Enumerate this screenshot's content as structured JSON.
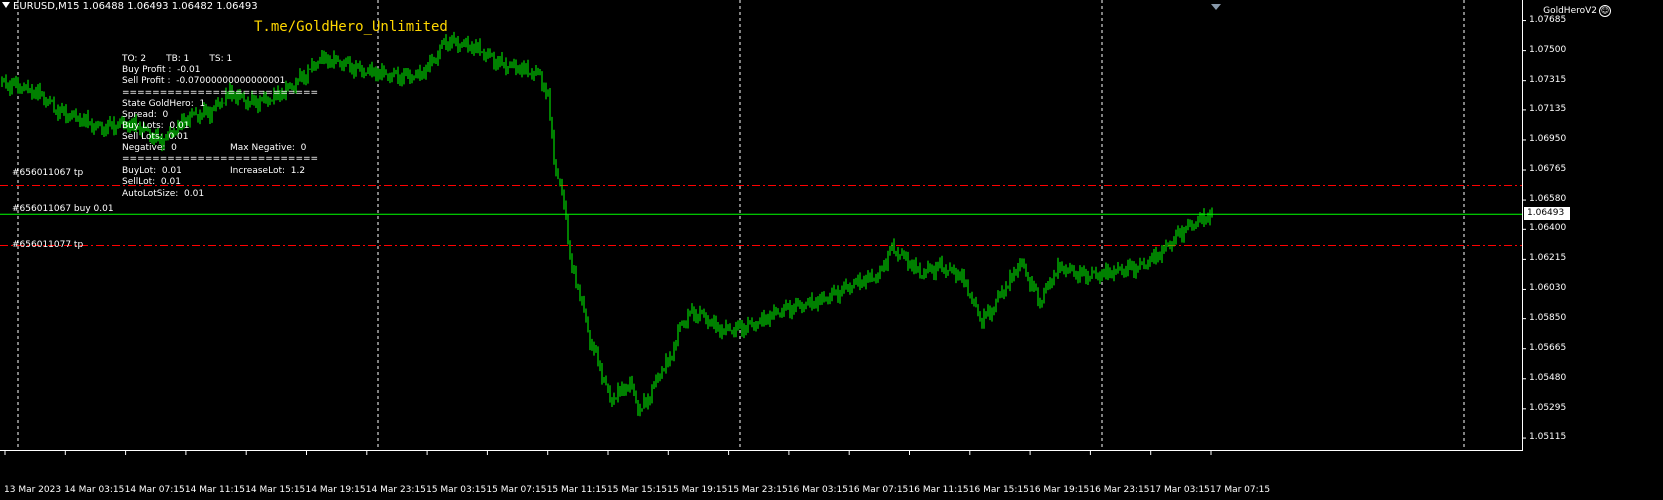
{
  "header": {
    "symbol_ohlc": "EURUSD,M15  1.06488 1.06493 1.06482 1.06493",
    "watermark": "T.me/GoldHero_Unlimited",
    "ea_name": "GoldHeroV2"
  },
  "panel": {
    "row1": "TO: 2       TB: 1       TS: 1",
    "buy_profit": "Buy Profit :  -0.01",
    "sell_profit": "Sell Profit :  -0.07000000000000001",
    "sep1": "==========================",
    "state": "State GoldHero:  1",
    "spread": "Spread:  0",
    "buy_lots": "Buy Lots:  0.01",
    "sell_lots": "Sell Lots:  0.01",
    "negative": "Negative:  0",
    "max_negative": "Max Negative:  0",
    "sep2": "==========================",
    "buy_lot": "BuyLot:  0.01",
    "increase_lot": "IncreaseLot:  1.2",
    "sell_lot": "SellLot:  0.01",
    "auto_lot": "AutoLotSize:  0.01"
  },
  "orders": {
    "tp_upper": "#656011067 tp",
    "buy_line": "#656011067 buy 0.01",
    "tp_lower": "#656011077 tp"
  },
  "colors": {
    "background": "#000000",
    "candles": "#00ff00",
    "tp_line": "#ff0000",
    "bid_line": "#00ff00",
    "watermark": "#ffd700",
    "axis": "#ffffff"
  },
  "chart_data": {
    "type": "line",
    "symbol": "EURUSD",
    "timeframe": "M15",
    "y_axis_labels": [
      "1.07685",
      "1.07500",
      "1.07315",
      "1.07135",
      "1.06950",
      "1.06765",
      "1.06580",
      "1.06400",
      "1.06215",
      "1.06030",
      "1.05850",
      "1.05665",
      "1.05480",
      "1.05295",
      "1.05115"
    ],
    "current_price": "1.06493",
    "tp_levels": [
      1.0667,
      1.063
    ],
    "x_axis_labels": [
      "13 Mar 2023",
      "14 Mar 03:15",
      "14 Mar 07:15",
      "14 Mar 11:15",
      "14 Mar 15:15",
      "14 Mar 19:15",
      "14 Mar 23:15",
      "15 Mar 03:15",
      "15 Mar 07:15",
      "15 Mar 11:15",
      "15 Mar 15:15",
      "15 Mar 19:15",
      "15 Mar 23:15",
      "16 Mar 03:15",
      "16 Mar 07:15",
      "16 Mar 11:15",
      "16 Mar 15:15",
      "16 Mar 19:15",
      "16 Mar 23:15",
      "17 Mar 03:15",
      "17 Mar 07:15"
    ],
    "ylim": [
      1.0506,
      1.0775
    ],
    "price_path": [
      [
        0,
        1.073
      ],
      [
        20,
        1.0728
      ],
      [
        40,
        1.0723
      ],
      [
        60,
        1.0712
      ],
      [
        80,
        1.0708
      ],
      [
        100,
        1.0702
      ],
      [
        120,
        1.0705
      ],
      [
        140,
        1.0703
      ],
      [
        160,
        1.0694
      ],
      [
        175,
        1.0701
      ],
      [
        190,
        1.071
      ],
      [
        210,
        1.0712
      ],
      [
        230,
        1.0724
      ],
      [
        250,
        1.0718
      ],
      [
        270,
        1.072
      ],
      [
        290,
        1.0727
      ],
      [
        310,
        1.0738
      ],
      [
        320,
        1.0745
      ],
      [
        340,
        1.0743
      ],
      [
        360,
        1.0738
      ],
      [
        380,
        1.0736
      ],
      [
        400,
        1.0734
      ],
      [
        420,
        1.0735
      ],
      [
        435,
        1.0745
      ],
      [
        445,
        1.0756
      ],
      [
        460,
        1.0754
      ],
      [
        475,
        1.0752
      ],
      [
        490,
        1.0746
      ],
      [
        500,
        1.0742
      ],
      [
        520,
        1.0739
      ],
      [
        540,
        1.0735
      ],
      [
        548,
        1.072
      ],
      [
        556,
        1.0675
      ],
      [
        565,
        1.0655
      ],
      [
        570,
        1.062
      ],
      [
        580,
        1.06
      ],
      [
        590,
        1.0572
      ],
      [
        600,
        1.0555
      ],
      [
        610,
        1.0535
      ],
      [
        620,
        1.054
      ],
      [
        630,
        1.0545
      ],
      [
        640,
        1.0528
      ],
      [
        650,
        1.0538
      ],
      [
        660,
        1.0552
      ],
      [
        670,
        1.056
      ],
      [
        680,
        1.058
      ],
      [
        690,
        1.0588
      ],
      [
        700,
        1.0588
      ],
      [
        720,
        1.0578
      ],
      [
        740,
        1.0579
      ],
      [
        760,
        1.0583
      ],
      [
        780,
        1.059
      ],
      [
        800,
        1.0593
      ],
      [
        820,
        1.0596
      ],
      [
        840,
        1.0602
      ],
      [
        860,
        1.0608
      ],
      [
        880,
        1.0612
      ],
      [
        890,
        1.0628
      ],
      [
        900,
        1.0625
      ],
      [
        920,
        1.0613
      ],
      [
        940,
        1.0617
      ],
      [
        960,
        1.0612
      ],
      [
        970,
        1.06
      ],
      [
        980,
        1.0585
      ],
      [
        990,
        1.0588
      ],
      [
        1000,
        1.06
      ],
      [
        1010,
        1.0608
      ],
      [
        1020,
        1.062
      ],
      [
        1030,
        1.0608
      ],
      [
        1040,
        1.0595
      ],
      [
        1050,
        1.0608
      ],
      [
        1060,
        1.0617
      ],
      [
        1080,
        1.0612
      ],
      [
        1100,
        1.0612
      ],
      [
        1120,
        1.0615
      ],
      [
        1140,
        1.0617
      ],
      [
        1160,
        1.0625
      ],
      [
        1180,
        1.0638
      ],
      [
        1200,
        1.0646
      ],
      [
        1212,
        1.0649
      ]
    ]
  }
}
